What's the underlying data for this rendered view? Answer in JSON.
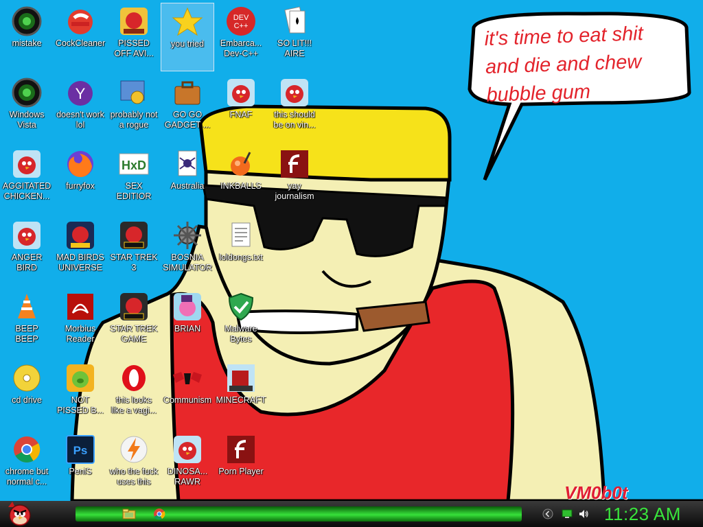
{
  "desktop": {
    "icons": [
      {
        "label": "mistake",
        "icon": "green-orb-icon"
      },
      {
        "label": "CockCleaner",
        "icon": "ccleaner-icon"
      },
      {
        "label": "PISSED\nOFF AVI...",
        "icon": "angry-birds-seasons-icon"
      },
      {
        "label": "you tried",
        "icon": "gold-star-icon"
      },
      {
        "label": "Embarca...\nDev-C++",
        "icon": "dev-cpp-icon"
      },
      {
        "label": "SO LIT!!!\nAIRE",
        "icon": "solitaire-cards-icon"
      },
      {
        "label": "Windows\nVista",
        "icon": "green-orb-icon"
      },
      {
        "label": "doesn't work\nlol",
        "icon": "yahoo-messenger-icon"
      },
      {
        "label": "probably not\na rogue",
        "icon": "gears-shield-icon"
      },
      {
        "label": "GO GO\nGADGET ...",
        "icon": "briefcase-icon"
      },
      {
        "label": "FNAF",
        "icon": "angry-bird-icon"
      },
      {
        "label": "this should\nbe on vin...",
        "icon": "angry-bird-icon"
      },
      {
        "label": "AGGITATED\nCHICKEN...",
        "icon": "angry-bird-icon"
      },
      {
        "label": "furryfox",
        "icon": "firefox-icon"
      },
      {
        "label": "SEX\nEDITIOR",
        "icon": "hxd-icon"
      },
      {
        "label": "Australia",
        "icon": "spider-solitaire-icon"
      },
      {
        "label": "INKBALLS",
        "icon": "inkball-icon"
      },
      {
        "label": "yay\njournalism",
        "icon": "flash-icon"
      },
      {
        "label": "ANGER\nBIRD",
        "icon": "angry-bird-icon"
      },
      {
        "label": "MAD BIRDS\nUNIVERSE",
        "icon": "angry-birds-space-icon"
      },
      {
        "label": "STAR TREK\n3",
        "icon": "angry-birds-star-wars-icon"
      },
      {
        "label": "BOSNIA\nSIMULATOR",
        "icon": "mine-icon"
      },
      {
        "label": "loldongs.txt",
        "icon": "text-document-icon"
      },
      {
        "label": "BEEP\nBEEP",
        "icon": "vlc-cone-icon"
      },
      {
        "label": "Morbius\nReader",
        "icon": "pdf-reader-icon"
      },
      {
        "label": "STAR TREK\nGAME",
        "icon": "angry-birds-star-wars-icon"
      },
      {
        "label": "BRIAN",
        "icon": "angry-birds-stella-icon"
      },
      {
        "label": "Malware\nBytes",
        "icon": "shield-check-icon"
      },
      {
        "label": "cd drive",
        "icon": "cd-drive-icon"
      },
      {
        "label": "NOT\nPISSED B...",
        "icon": "bad-piggies-icon"
      },
      {
        "label": "this looks\nlike a vagi...",
        "icon": "opera-icon"
      },
      {
        "label": "Communism",
        "icon": "hammer-sickle-icon"
      },
      {
        "label": "MINECRAFT",
        "icon": "minecraft-bird-icon"
      },
      {
        "label": "chrome but\nnormal c...",
        "icon": "chrome-icon"
      },
      {
        "label": "PeniS",
        "icon": "photoshop-icon"
      },
      {
        "label": "who the fuck\nuses this",
        "icon": "avast-icon"
      },
      {
        "label": "DINOSA...\nRAWR",
        "icon": "angry-bird-icon"
      },
      {
        "label": "Porn Player",
        "icon": "flash-icon"
      }
    ]
  },
  "wallpaper": {
    "speech_bubble": "it's time to eat shit\nand die and chew\nbubble gum",
    "signature": "VM0b0t"
  },
  "taskbar": {
    "start_icon": "angry-bird-start-icon",
    "pinned": [
      {
        "name": "explorer-folder-icon"
      },
      {
        "name": "chrome-icon"
      }
    ],
    "tray": [
      "chevron-icon",
      "network-icon",
      "volume-icon"
    ],
    "clock": "11:23 AM"
  },
  "colors": {
    "desktop_bg": "#11aeea",
    "taskbar_green": "#37e13a",
    "clock": "#39e43c",
    "bubble_text": "#e3232b"
  }
}
